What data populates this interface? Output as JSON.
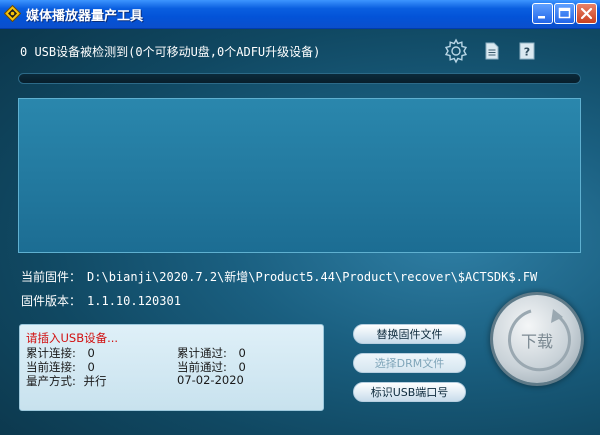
{
  "window": {
    "title": "媒体播放器量产工具",
    "icons": {
      "app": "app-diamond-icon",
      "minimize": "minimize-icon",
      "maximize": "maximize-icon",
      "close": "close-icon"
    }
  },
  "status": {
    "detected_text": "0 USB设备被检测到(0个可移动U盘,0个ADFU升级设备)"
  },
  "toolbar_icons": [
    "settings-gear-icon",
    "document-icon",
    "help-icon"
  ],
  "firmware": {
    "path_label": "当前固件：",
    "path_value": "D:\\bianji\\2020.7.2\\新增\\Product5.44\\Product\\recover\\$ACTSDK$.FW",
    "version_label": "固件版本：",
    "version_value": "1.1.10.120301"
  },
  "statusbox": {
    "prompt": "请插入USB设备...",
    "total_connect_label": "累计连接:",
    "total_connect_value": "0",
    "total_pass_label": "累计通过:",
    "total_pass_value": "0",
    "current_connect_label": "当前连接:",
    "current_connect_value": "0",
    "current_pass_label": "当前通过:",
    "current_pass_value": "0",
    "mode_label": "量产方式:",
    "mode_value": "并行",
    "date": "07-02-2020"
  },
  "buttons": {
    "replace_firmware": "替换固件文件",
    "select_drm": "选择DRM文件",
    "mark_usb_port": "标识USB端口号",
    "download": "下载"
  },
  "colors": {
    "titlebar": "#0353d8",
    "background": "#1a5f80",
    "prompt_red": "#d21010"
  }
}
